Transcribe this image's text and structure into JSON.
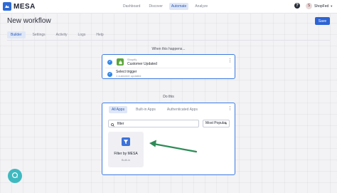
{
  "header": {
    "brand": "MESA",
    "nav": [
      "Dashboard",
      "Discover",
      "Automate",
      "Analyze"
    ],
    "nav_active_index": 2,
    "help_label": "?",
    "user": {
      "initial": "S",
      "name": "ShopFed"
    }
  },
  "page": {
    "title": "New workflow",
    "save_label": "Save",
    "tabs": [
      "Builder",
      "Settings",
      "Activity",
      "Logs",
      "Help"
    ],
    "active_tab_index": 0
  },
  "trigger": {
    "heading": "When this happens...",
    "app_label": "Shopify",
    "event_label": "Customer Updated",
    "step_title": "Select trigger",
    "step_subtitle": "1 customer updated"
  },
  "action": {
    "heading": "Do this",
    "tabs": [
      "All Apps",
      "Built-in Apps",
      "Authenticated Apps"
    ],
    "active_tab_index": 0,
    "search_value": "filter",
    "sort_value": "Most Popular",
    "results": [
      {
        "name": "Filter by MESA",
        "subtitle": "Built-in",
        "icon": "filter-icon"
      }
    ]
  },
  "colors": {
    "accent": "#2d63d3",
    "card_border": "#3b7ae0",
    "shopify": "#5aa63a",
    "annotation_arrow": "#2e8b57",
    "chat": "#3fb9c0"
  },
  "icons": [
    "mesa-logo-icon",
    "help-icon",
    "chevron-down-icon",
    "check-icon",
    "shopify-icon",
    "kebab-menu-icon",
    "search-icon",
    "filter-icon",
    "chat-icon"
  ]
}
